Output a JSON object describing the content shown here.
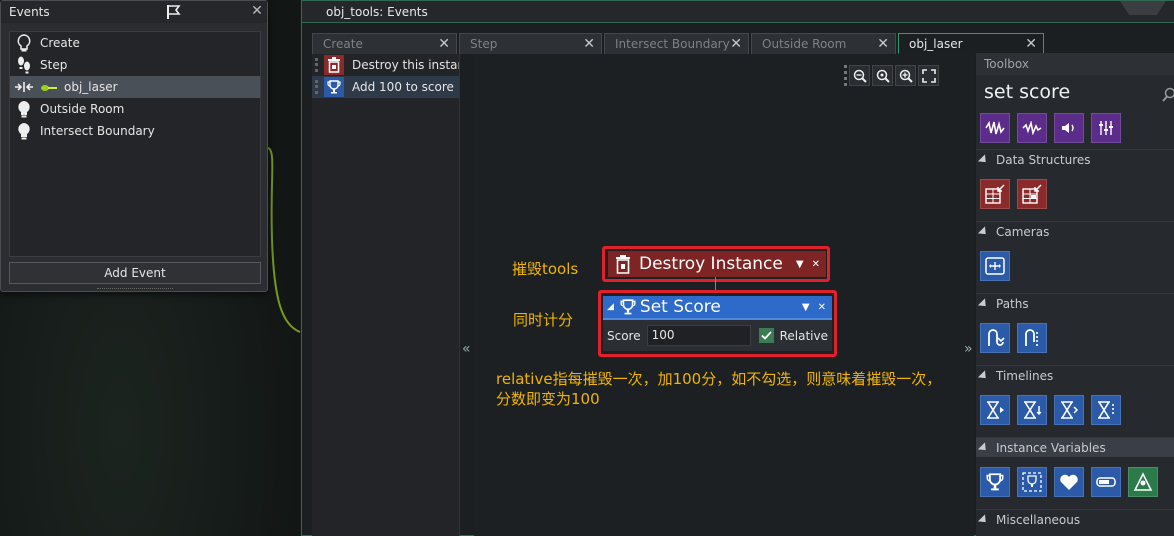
{
  "events_panel": {
    "title": "Events",
    "items": [
      {
        "label": "Create",
        "icon": "bulb-icon"
      },
      {
        "label": "Step",
        "icon": "footsteps-icon"
      },
      {
        "label": "obj_laser",
        "icon": "collision-icon"
      },
      {
        "label": "Outside Room",
        "icon": "bulb-icon"
      },
      {
        "label": "Intersect Boundary",
        "icon": "bulb-icon"
      }
    ],
    "selected_index": 2,
    "add_event_label": "Add Event"
  },
  "object_window": {
    "title": "obj_tools: Events",
    "tabs": [
      {
        "label": "Create",
        "active": false
      },
      {
        "label": "Step",
        "active": false
      },
      {
        "label": "Intersect Boundary",
        "active": false
      },
      {
        "label": "Outside Room",
        "active": false
      },
      {
        "label": "obj_laser",
        "active": true
      }
    ],
    "action_list": [
      {
        "label": "Destroy this instance",
        "color": "#8a2a2a",
        "icon": "trash-icon"
      },
      {
        "label": "Add 100 to score",
        "color": "#2a5aa8",
        "icon": "trophy-icon"
      }
    ]
  },
  "canvas": {
    "annotation_destroy": "摧毁tools",
    "annotation_score": "同时计分",
    "annotation_note_line1": "relative指每摧毁一次，加100分，如不勾选，则意味着摧毁一次，",
    "annotation_note_line2": "分数即变为100",
    "destroy_block": {
      "title": "Destroy Instance"
    },
    "score_block": {
      "title": "Set Score",
      "field_label": "Score",
      "field_value": "100",
      "relative_label": "Relative",
      "relative_checked": true
    }
  },
  "toolbox": {
    "title": "Toolbox",
    "search_text": "set score",
    "sections": [
      {
        "label": "Data Structures"
      },
      {
        "label": "Cameras"
      },
      {
        "label": "Paths"
      },
      {
        "label": "Timelines"
      },
      {
        "label": "Instance Variables"
      },
      {
        "label": "Miscellaneous"
      }
    ]
  },
  "colors": {
    "accent_green": "#2f9b6e",
    "action_red": "#8a2a2a",
    "action_blue": "#2a5aa8",
    "annotation": "#f0b400",
    "highlight_frame": "#e0202a"
  }
}
